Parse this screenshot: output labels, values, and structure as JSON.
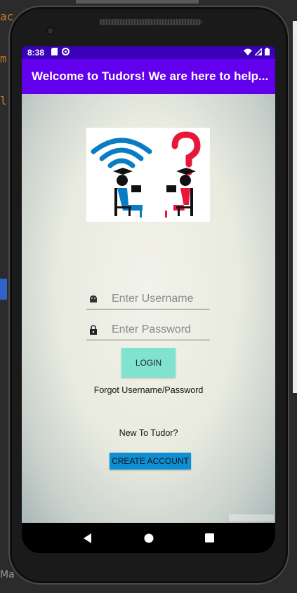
{
  "ide": {
    "line1": "ac",
    "line2": "m",
    "line3": "l",
    "bottom_label": "Ma"
  },
  "status_bar": {
    "time": "8:38",
    "icons_left": [
      "sd-card-icon",
      "sync-icon"
    ],
    "icons_right": [
      "wifi-icon",
      "signal-icon",
      "battery-icon"
    ]
  },
  "app_bar": {
    "title": "Welcome to Tudors! We are here to help..."
  },
  "login": {
    "username_placeholder": "Enter Username",
    "password_placeholder": "Enter Password",
    "login_label": "LOGIN",
    "forgot_label": "Forgot Username/Password",
    "new_to_label": "New To Tudor?",
    "create_account_label": "CREATE ACCOUNT"
  },
  "colors": {
    "status_bar": "#3a00b8",
    "app_bar": "#6200ee",
    "login_button": "#7fe3cf",
    "create_button": "#0e8fd4",
    "logo_blue": "#0a7cc4",
    "logo_red": "#e8173a"
  },
  "nav": {
    "icons": [
      "back-icon",
      "home-icon",
      "recents-icon"
    ]
  }
}
